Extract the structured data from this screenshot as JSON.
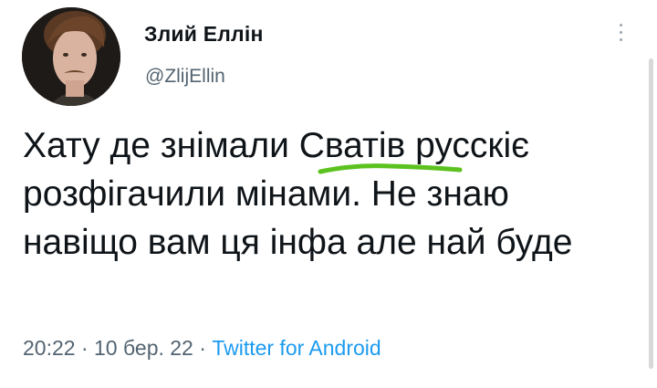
{
  "tweet": {
    "display_name": "Злий Еллін",
    "handle": "@ZlijEllin",
    "text": "Хату де знімали Сватів русскіє розфігачили мінами. Не знаю навіщо вам ця інфа але най буде",
    "highlighted_word": "Сватів",
    "time": "20:22",
    "date": "10 бер. 22",
    "separator": "·",
    "source": "Twitter for Android"
  },
  "icons": {
    "more": "more-vertical-icon"
  },
  "colors": {
    "text": "#0f1419",
    "secondary": "#536471",
    "link": "#1d9bf0",
    "highlight_underline": "#5cc21f"
  }
}
